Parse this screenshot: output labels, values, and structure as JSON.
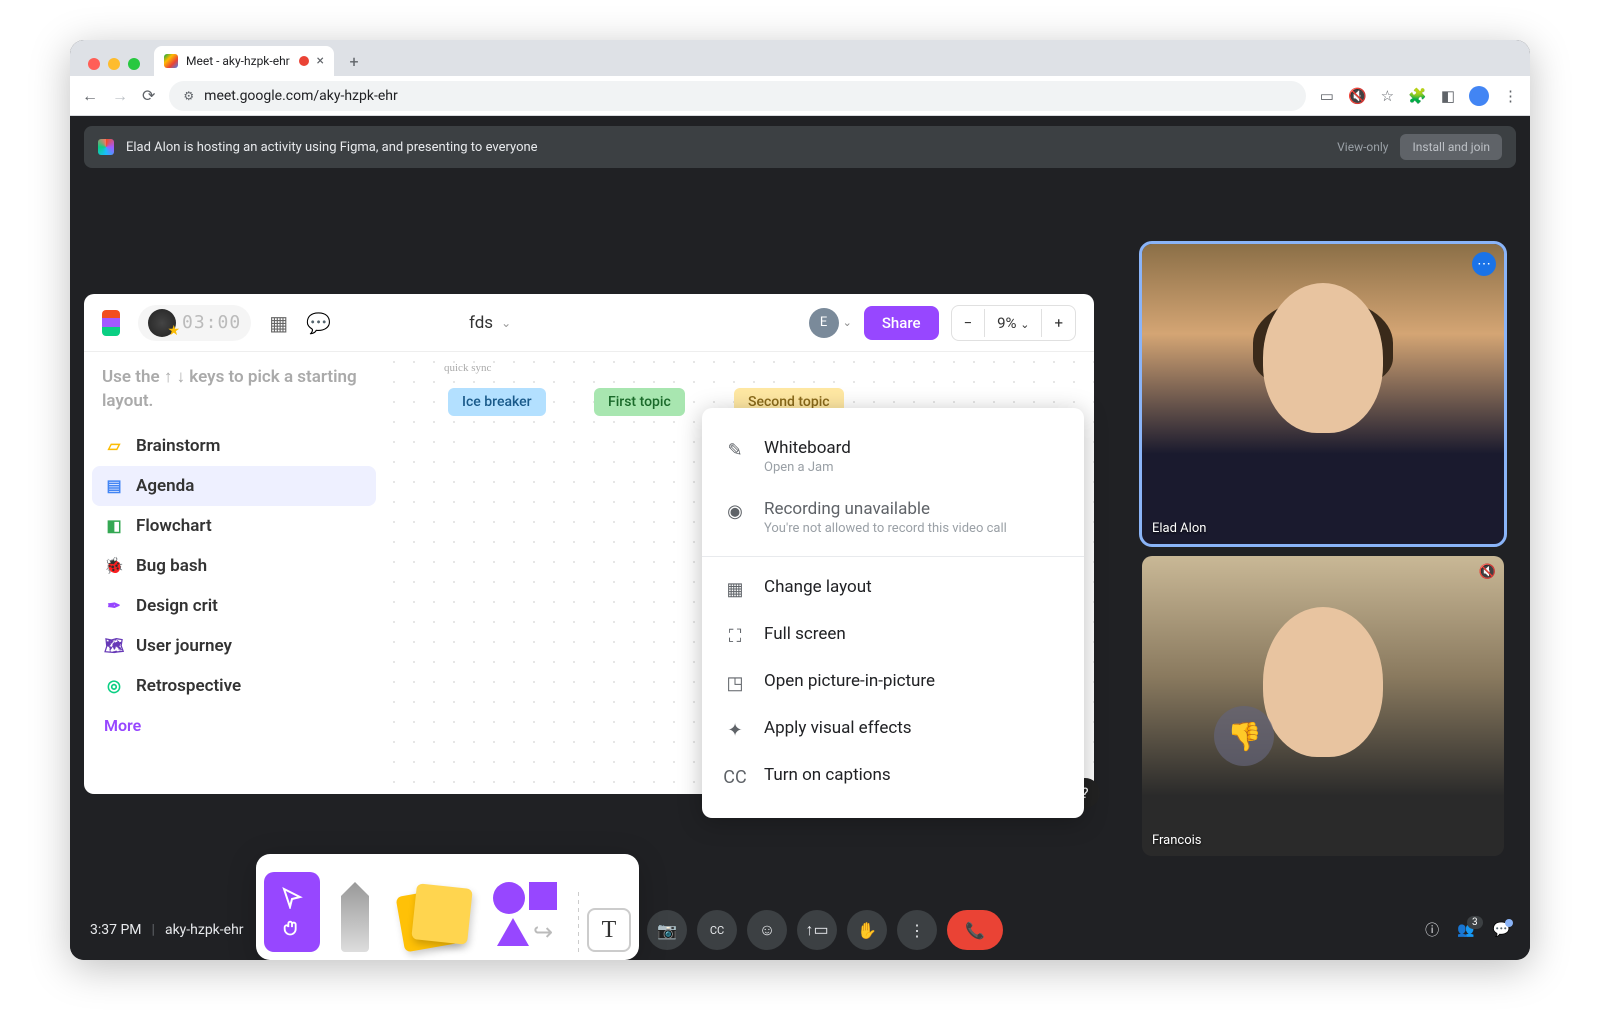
{
  "browser": {
    "tab_title": "Meet - aky-hzpk-ehr",
    "url": "meet.google.com/aky-hzpk-ehr"
  },
  "banner": {
    "text": "Elad Alon is hosting an activity using Figma, and presenting to everyone",
    "view_only": "View-only",
    "install": "Install and join"
  },
  "figma": {
    "timer": "03:00",
    "doc_title": "fds",
    "avatar_initial": "E",
    "share": "Share",
    "zoom": "9%",
    "hint": "Use the ↑ ↓ keys to pick a starting layout.",
    "templates": [
      {
        "icon": "💡",
        "label": "Brainstorm",
        "color": "#fbbc04"
      },
      {
        "icon": "📋",
        "label": "Agenda",
        "color": "#4285f4"
      },
      {
        "icon": "🔀",
        "label": "Flowchart",
        "color": "#34a853"
      },
      {
        "icon": "🐞",
        "label": "Bug bash",
        "color": "#ea4335"
      },
      {
        "icon": "✒️",
        "label": "Design crit",
        "color": "#9747ff"
      },
      {
        "icon": "🗺️",
        "label": "User journey",
        "color": "#673ab7"
      },
      {
        "icon": "◎",
        "label": "Retrospective",
        "color": "#0acf83"
      }
    ],
    "selected_template_index": 1,
    "more": "More",
    "canvas": {
      "note": "quick sync",
      "chips": [
        "Ice breaker",
        "First topic",
        "Second topic"
      ]
    }
  },
  "popover": {
    "whiteboard_title": "Whiteboard",
    "whiteboard_sub": "Open a Jam",
    "recording_title": "Recording unavailable",
    "recording_sub": "You're not allowed to record this video call",
    "items": [
      "Change layout",
      "Full screen",
      "Open picture-in-picture",
      "Apply visual effects",
      "Turn on captions"
    ]
  },
  "videos": [
    {
      "name": "Elad Alon",
      "active": true,
      "muted": false
    },
    {
      "name": "Francois",
      "active": false,
      "muted": true
    }
  ],
  "meetbar": {
    "time": "3:37 PM",
    "code": "aky-hzpk-ehr",
    "participant_count": "3"
  }
}
